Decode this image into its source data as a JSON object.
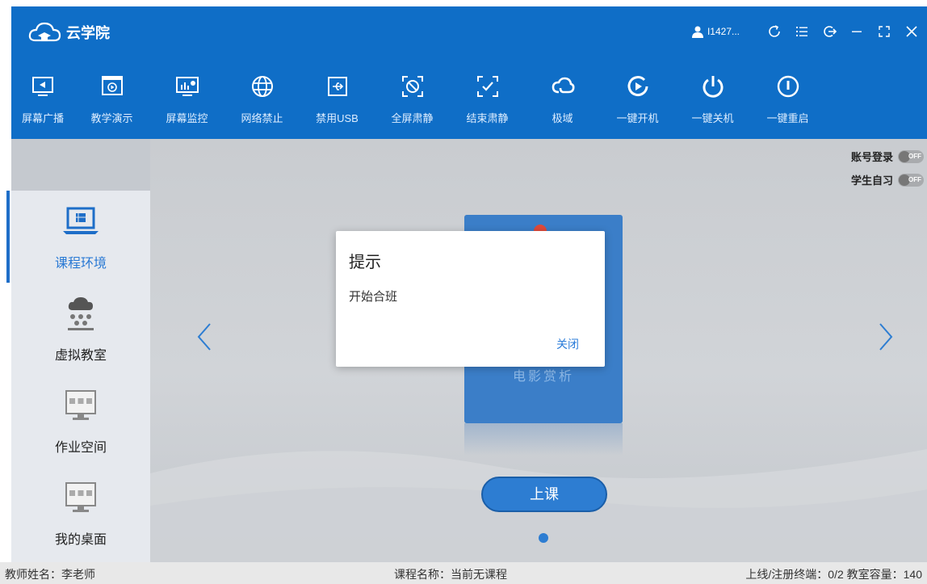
{
  "app": {
    "title": "云学院"
  },
  "user": {
    "name": "I1427..."
  },
  "title_controls": [
    "refresh-icon",
    "menu-list-icon",
    "logout-icon",
    "minimize-icon",
    "fullscreen-icon",
    "close-icon"
  ],
  "toolbar": [
    {
      "label": "屏幕广播",
      "icon": "screen-broadcast-icon"
    },
    {
      "label": "教学演示",
      "icon": "teaching-demo-icon"
    },
    {
      "label": "屏幕监控",
      "icon": "screen-monitor-icon"
    },
    {
      "label": "网络禁止",
      "icon": "network-ban-icon"
    },
    {
      "label": "禁用USB",
      "icon": "usb-ban-icon"
    },
    {
      "label": "全屏肃静",
      "icon": "fullscreen-silence-icon"
    },
    {
      "label": "结束肃静",
      "icon": "end-silence-icon"
    },
    {
      "label": "极域",
      "icon": "jiyu-cloud-icon"
    },
    {
      "label": "一键开机",
      "icon": "power-on-icon"
    },
    {
      "label": "一键关机",
      "icon": "power-off-icon"
    },
    {
      "label": "一键重启",
      "icon": "restart-icon"
    }
  ],
  "sidebar": {
    "items": [
      {
        "label": "课程环境",
        "icon": "laptop-icon",
        "active": true
      },
      {
        "label": "虚拟教室",
        "icon": "cloud-classroom-icon",
        "active": false
      },
      {
        "label": "作业空间",
        "icon": "monitor-grid-icon",
        "active": false
      },
      {
        "label": "我的桌面",
        "icon": "monitor-grid-icon",
        "active": false
      }
    ]
  },
  "toggles": {
    "account_login": {
      "label": "账号登录",
      "state": "OFF"
    },
    "self_study": {
      "label": "学生自习",
      "state": "OFF"
    }
  },
  "carousel": {
    "course_name": "电影赏析"
  },
  "main": {
    "start_button": "上课"
  },
  "dialog": {
    "title": "提示",
    "message": "开始合班",
    "close_label": "关闭"
  },
  "status": {
    "teacher": "教师姓名：李老师",
    "course": "课程名称：当前无课程",
    "terminals": "上线/注册终端：0/2  教室容量：140"
  },
  "colors": {
    "primary": "#0f6ec7",
    "accent": "#2d7dd2",
    "link": "#2b7cd9"
  }
}
